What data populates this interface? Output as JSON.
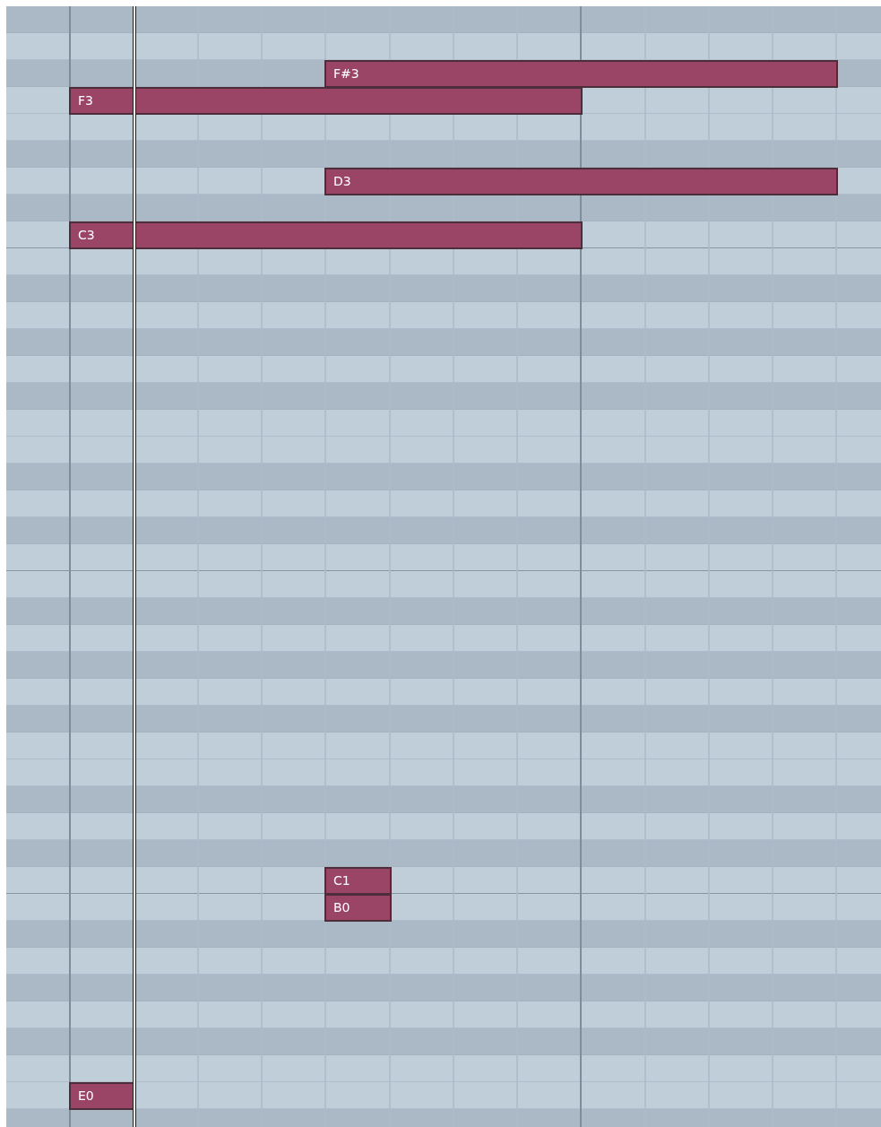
{
  "piano_roll": {
    "notes": [
      {
        "label": "F#3"
      },
      {
        "label": "F3"
      },
      {
        "label": "D3"
      },
      {
        "label": "C3"
      },
      {
        "label": "C1"
      },
      {
        "label": "B0"
      },
      {
        "label": "E0"
      }
    ]
  }
}
